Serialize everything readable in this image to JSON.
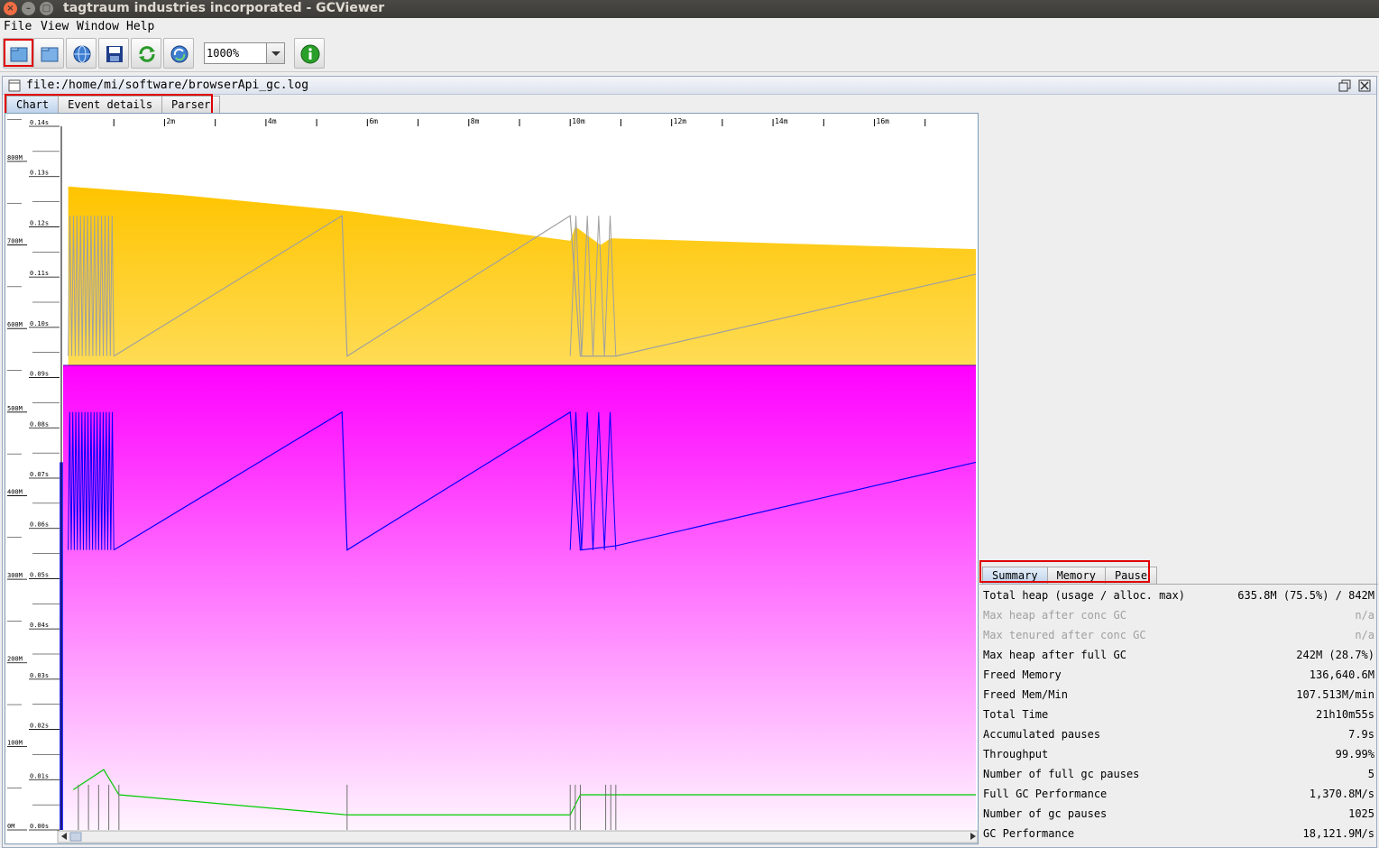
{
  "window": {
    "title": "tagtraum industries incorporated - GCViewer"
  },
  "menu": {
    "items": [
      "File",
      "View",
      "Window",
      "Help"
    ]
  },
  "toolbar": {
    "zoom_value": "1000%",
    "buttons": [
      "open-file-icon",
      "open-url-icon",
      "open-url-globe-icon",
      "save-icon",
      "refresh-icon",
      "watch-icon",
      "about-icon"
    ]
  },
  "document": {
    "file_path": "file:/home/mi/software/browserApi_gc.log"
  },
  "chart_tabs": [
    "Chart",
    "Event details",
    "Parser"
  ],
  "summary_tabs": [
    "Summary",
    "Memory",
    "Pause"
  ],
  "summary": {
    "rows": [
      {
        "label": "Total heap (usage / alloc. max)",
        "value": "635.8M (75.5%) / 842M",
        "enabled": true
      },
      {
        "label": "Max heap after conc GC",
        "value": "n/a",
        "enabled": false
      },
      {
        "label": "Max tenured after conc GC",
        "value": "n/a",
        "enabled": false
      },
      {
        "label": "Max heap after full GC",
        "value": "242M (28.7%)",
        "enabled": true
      },
      {
        "label": "Freed Memory",
        "value": "136,640.6M",
        "enabled": true
      },
      {
        "label": "Freed Mem/Min",
        "value": "107.513M/min",
        "enabled": true
      },
      {
        "label": "Total Time",
        "value": "21h10m55s",
        "enabled": true
      },
      {
        "label": "Accumulated pauses",
        "value": "7.9s",
        "enabled": true
      },
      {
        "label": "Throughput",
        "value": "99.99%",
        "enabled": true
      },
      {
        "label": "Number of full gc pauses",
        "value": "5",
        "enabled": true
      },
      {
        "label": "Full GC Performance",
        "value": "1,370.8M/s",
        "enabled": true
      },
      {
        "label": "Number of gc pauses",
        "value": "1025",
        "enabled": true
      },
      {
        "label": "GC Performance",
        "value": "18,121.9M/s",
        "enabled": true
      }
    ]
  },
  "chart_data": {
    "type": "area",
    "x_ticks": [
      "2m",
      "4m",
      "6m",
      "8m",
      "10m",
      "12m",
      "14m",
      "16m"
    ],
    "memory_ticks": [
      "800M",
      "700M",
      "600M",
      "500M",
      "400M",
      "300M",
      "200M",
      "100M",
      "0M"
    ],
    "pause_ticks": [
      "0.14s",
      "0.13s",
      "0.12s",
      "0.11s",
      "0.10s",
      "0.09s",
      "0.08s",
      "0.07s",
      "0.06s",
      "0.05s",
      "0.04s",
      "0.03s",
      "0.02s",
      "0.01s",
      "0.00s"
    ],
    "memory_ylim": [
      0,
      842
    ],
    "x_range_minutes": [
      0,
      18
    ],
    "series": [
      {
        "kind": "total-heap",
        "color": "#ffc400",
        "x": [
          0.1,
          2.3,
          5.7,
          10.0,
          10.1,
          10.6,
          10.8,
          18.0
        ],
        "y": [
          770,
          760,
          740,
          705,
          722,
          700,
          708,
          695
        ]
      },
      {
        "kind": "tenured",
        "color": "#ff00ff",
        "x": [
          0,
          18
        ],
        "y": [
          556,
          556
        ]
      },
      {
        "kind": "used-heap-young",
        "color": "#a0a0a0",
        "x": [
          1.0,
          5.5,
          5.6,
          10.0,
          10.2,
          10.9,
          18.0
        ],
        "y": [
          567,
          735,
          567,
          735,
          567,
          567,
          665
        ]
      },
      {
        "kind": "used-heap-tenured",
        "color": "#0000ff",
        "x": [
          1.0,
          5.5,
          5.6,
          10.0,
          10.2,
          10.9,
          18.0
        ],
        "y": [
          335,
          500,
          335,
          500,
          335,
          340,
          440
        ]
      },
      {
        "kind": "gc-pause",
        "color": "#00cc00",
        "x": [
          0.2,
          0.8,
          1.1,
          5.6,
          10.0,
          10.2,
          10.9,
          18.0
        ],
        "y": [
          0.008,
          0.012,
          0.007,
          0.003,
          0.003,
          0.007,
          0.007,
          0.007
        ]
      }
    ]
  }
}
